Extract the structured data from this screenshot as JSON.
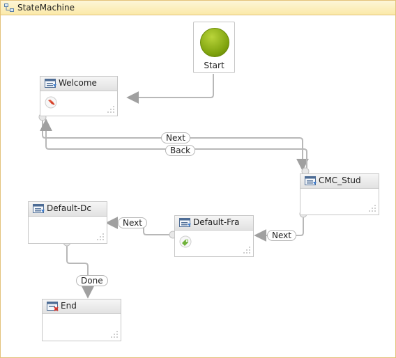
{
  "designer": {
    "title": "StateMachine"
  },
  "start": {
    "label": "Start"
  },
  "states": {
    "welcome": {
      "label": "Welcome"
    },
    "cmc_stud": {
      "label": "CMC_Stud"
    },
    "default_fra": {
      "label": "Default-Fra"
    },
    "default_dc": {
      "label": "Default-Dc"
    },
    "end": {
      "label": "End"
    }
  },
  "transitions": {
    "welcome_to_cmc": "Next",
    "cmc_to_welcome": "Back",
    "cmc_to_fra": "Next",
    "fra_to_dc": "Next",
    "dc_to_end": "Done"
  },
  "colors": {
    "frame_border": "#e3c27a",
    "title_bar": "#fbe9a8",
    "wire": "#a0a0a0",
    "start_fill": "#8fb21a"
  }
}
